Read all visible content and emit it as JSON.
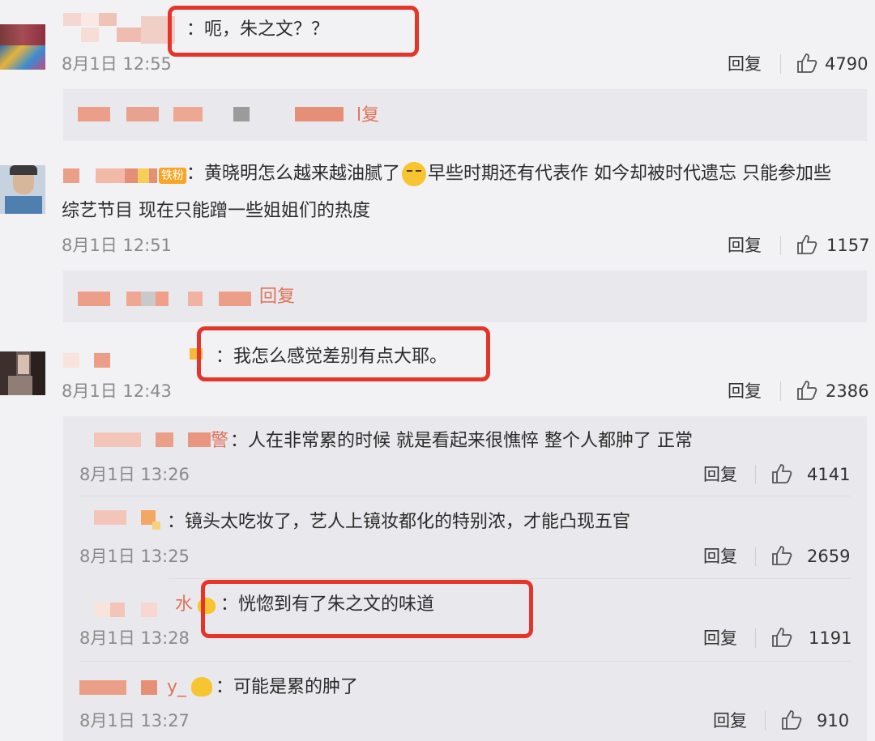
{
  "comments": [
    {
      "text": "：呃，朱之文？？",
      "date": "8月1日 12:55",
      "reply": "回复",
      "likes": "4790"
    },
    {
      "text_a": "：黄晓明怎么越来越油腻了",
      "text_b": "早些时期还有代表作 如今却被时代遗忘 只能参加些",
      "text_c": "综艺节目 现在只能蹭一些姐姐们的热度",
      "badge": "铁粉",
      "date": "8月1日 12:51",
      "reply": "回复",
      "likes": "1157"
    },
    {
      "text": "：我怎么感觉差别有点大耶。",
      "date": "8月1日 12:43",
      "reply": "回复",
      "likes": "2386"
    }
  ],
  "subreply_snippets": {
    "first": "l复",
    "second": "回复"
  },
  "replies": [
    {
      "name_tail": "警",
      "text": "：人在非常累的时候 就是看起来很憔悴 整个人都肿了 正常",
      "date": "8月1日 13:26",
      "reply": "回复",
      "likes": "4141"
    },
    {
      "text": "：镜头太吃妆了，艺人上镜妆都化的特别浓，才能凸现五官",
      "date": "8月1日 13:25",
      "reply": "回复",
      "likes": "2659"
    },
    {
      "name_tail": "水",
      "text": "：恍惚到有了朱之文的味道",
      "date": "8月1日 13:28",
      "reply": "回复",
      "likes": "1191"
    },
    {
      "name_tail": "y_",
      "text": "：可能是累的肿了",
      "date": "8月1日 13:27",
      "reply": "回复",
      "likes": "910"
    }
  ],
  "colors": {
    "highlight_box": "#e5352b",
    "link": "#e0735a",
    "background": "#f2f2f5"
  },
  "icons": {
    "like": "thumbs-up-icon",
    "emoji": "smirk-emoji-icon"
  }
}
